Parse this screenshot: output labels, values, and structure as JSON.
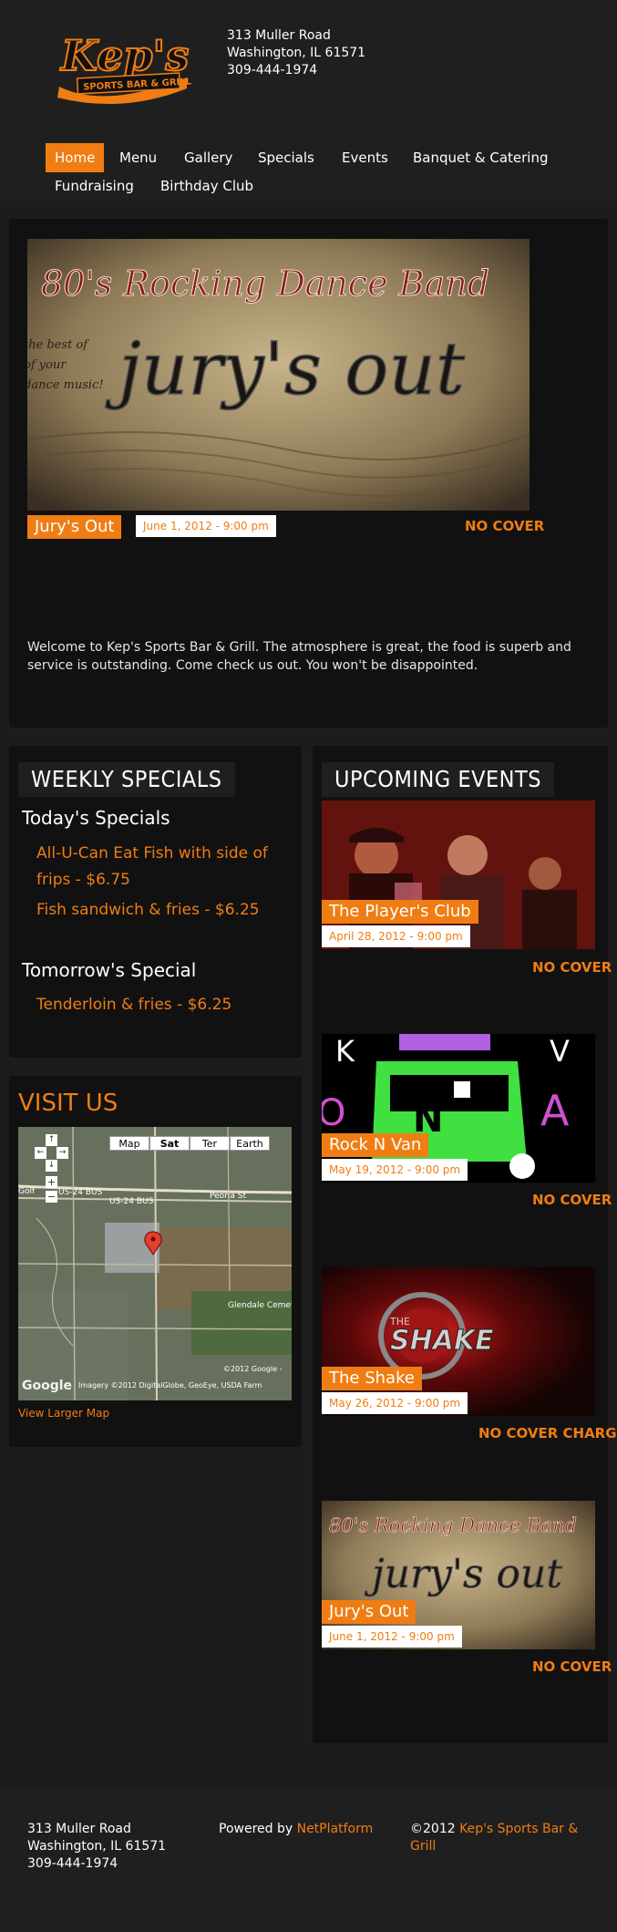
{
  "brand": {
    "logo_main": "Kep's",
    "logo_sub": "SPORTS BAR & GRILL",
    "accent": "#f07d13"
  },
  "contact": {
    "street": "313 Muller Road",
    "city": "Washington, IL 61571",
    "phone": "309-444-1974"
  },
  "nav": [
    "Home",
    "Menu",
    "Gallery",
    "Specials",
    "Events",
    "Banquet & Catering",
    "Fundraising",
    "Birthday Club"
  ],
  "hero": {
    "banner_line1": "80's Rocking Dance Band",
    "banner_side": [
      "the best of",
      "of your",
      "dance music!"
    ],
    "banner_main": "jury's out",
    "tag": "Jury's Out",
    "date": "June 1, 2012 - 9:00 pm",
    "cover": "NO COVER",
    "welcome": "Welcome to Kep's Sports Bar & Grill. The atmosphere is great, the food is superb and service is outstanding. Come check us out. You won't be disappointed."
  },
  "specials": {
    "title": "WEEKLY SPECIALS",
    "today_heading": "Today's Specials",
    "today": [
      "All-U-Can Eat Fish with side of frips - $6.75",
      "Fish sandwich & fries - $6.25"
    ],
    "tomorrow_heading": "Tomorrow's Special",
    "tomorrow": [
      "Tenderloin & fries - $6.25"
    ]
  },
  "visit": {
    "title": "VISIT US",
    "map_buttons": [
      "Map",
      "Sat",
      "Ter",
      "Earth"
    ],
    "map_labels": [
      "US-24 BUS",
      "US-24 BUS",
      "Peoria St",
      "Glendale Cemetery",
      "Golf"
    ],
    "map_copyright": "©2012 Google -",
    "map_imagery": "Imagery ©2012 DigitalGlobe, GeoEye, USDA Farm",
    "map_google": "Google",
    "link": "View Larger Map"
  },
  "events": {
    "title": "UPCOMING EVENTS",
    "items": [
      {
        "name": "The Player's Club",
        "date": "April 28, 2012 - 9:00 pm",
        "cover": "NO COVER"
      },
      {
        "name": "Rock N Van",
        "date": "May 19, 2012 - 9:00 pm",
        "cover": "NO COVER"
      },
      {
        "name": "The Shake",
        "date": "May 26, 2012 - 9:00 pm",
        "cover": "NO COVER CHARGE"
      },
      {
        "name": "Jury's Out",
        "date": "June 1, 2012 - 9:00 pm",
        "cover": "NO COVER"
      }
    ],
    "rocknvan_letters": "N",
    "shake_logo": "SHAKE",
    "shake_the": "THE"
  },
  "footer": {
    "street": "313 Muller Road",
    "city": "Washington, IL 61571",
    "phone": "309-444-1974",
    "powered_prefix": "Powered by ",
    "powered_link": "NetPlatform",
    "copyright_prefix": "©2012 ",
    "copyright_link": "Kep's Sports Bar & Grill"
  }
}
